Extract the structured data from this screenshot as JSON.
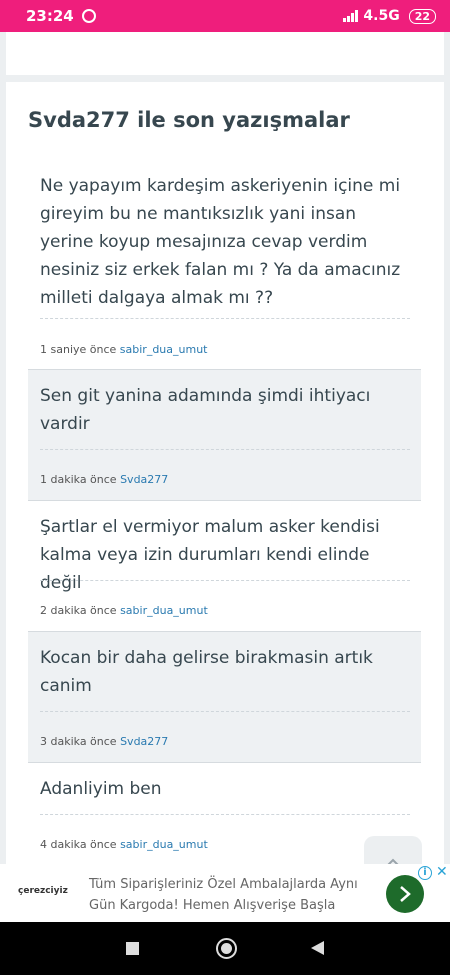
{
  "status_bar": {
    "time": "23:24",
    "network": "4.5G",
    "battery": "22"
  },
  "page": {
    "title": "Svda277 ile son yazışmalar"
  },
  "messages": [
    {
      "text": "Ne yapayım kardeşim askeriyenin içine mi gireyim bu ne mantıksızlık yani insan yerine koyup mesajınıza cevap verdim nesiniz siz erkek falan mı ? Ya da amacınız milleti dalgaya almak mı ??",
      "time": "1 saniye önce",
      "author": "sabir_dua_umut"
    },
    {
      "text": "Sen git yanina  adamında  şimdi  ihtiyacı vardir",
      "time": "1 dakika önce",
      "author": "Svda277"
    },
    {
      "text": "Şartlar el vermiyor malum asker kendisi kalma veya izin durumları kendi elinde değil",
      "time": "2 dakika önce",
      "author": "sabir_dua_umut"
    },
    {
      "text": "Kocan bir daha gelirse birakmasin  artık canim",
      "time": "3 dakika önce",
      "author": "Svda277"
    },
    {
      "text": "Adanliyim ben",
      "time": "4 dakika önce",
      "author": "sabir_dua_umut"
    }
  ],
  "ad": {
    "brand": "çerezciyiz",
    "text": "Tüm Siparişleriniz Özel Ambalajlarda Aynı Gün Kargoda! Hemen Alışverişe Başla"
  },
  "icons": {
    "alarm": "alarm-clock-icon",
    "scroll_top": "chevron-up-icon",
    "ad_go": "chevron-right-icon"
  },
  "colors": {
    "status_bar": "#ef1e7c",
    "link": "#2a7ab0",
    "ad_button": "#1e6b2b"
  }
}
